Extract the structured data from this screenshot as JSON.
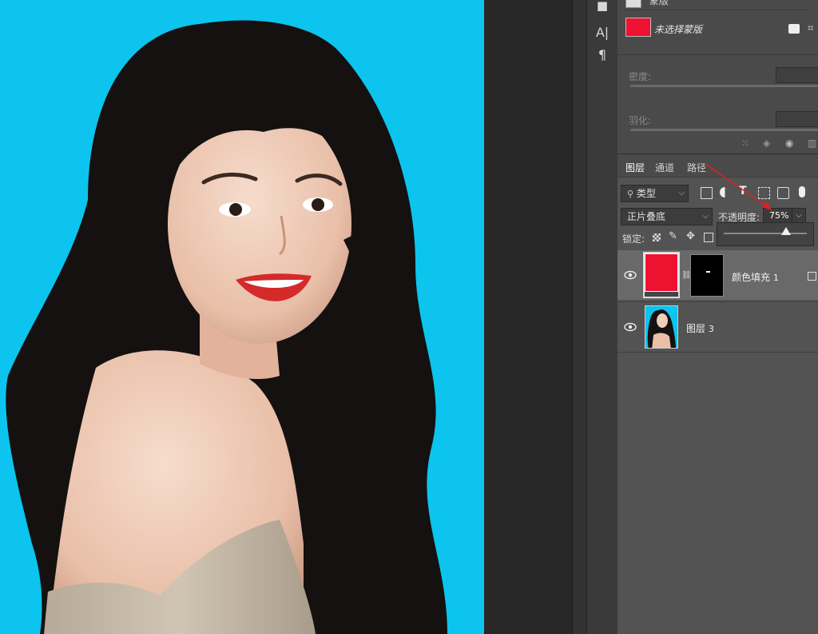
{
  "properties": {
    "header_partial": "蒙版",
    "mask_label": "未选择蒙版",
    "density_label": "密度:",
    "feather_label": "羽化:"
  },
  "layers_panel": {
    "tabs": [
      {
        "label": "图层",
        "active": true
      },
      {
        "label": "通道",
        "active": false
      },
      {
        "label": "路径",
        "active": false
      }
    ],
    "filter_kind": "类型",
    "blend_mode": "正片叠底",
    "opacity_label": "不透明度:",
    "opacity_value": "75%",
    "opacity_slider_fraction": 0.75,
    "lock_label": "锁定:",
    "layers": [
      {
        "name": "颜色填充",
        "suffix": "1",
        "fill_color": "#ee1230",
        "selected": true
      },
      {
        "name": "图层",
        "suffix": "3",
        "selected": false
      }
    ]
  },
  "colors": {
    "canvas_bg": "#0cc4ee",
    "fill": "#ee1230",
    "annotation_arrow": "#e02020"
  }
}
